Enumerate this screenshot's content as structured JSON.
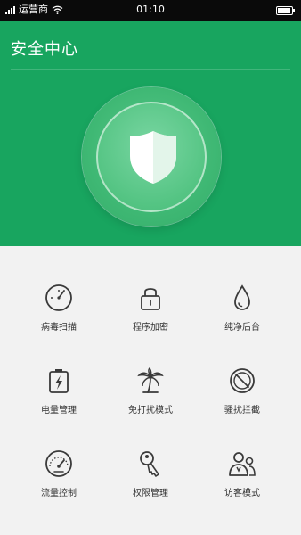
{
  "status_bar": {
    "carrier": "运营商",
    "time": "01:10"
  },
  "header": {
    "title": "安全中心"
  },
  "features": [
    {
      "label": "病毒扫描",
      "icon": "virus-scan-dial-icon"
    },
    {
      "label": "程序加密",
      "icon": "padlock-icon"
    },
    {
      "label": "纯净后台",
      "icon": "water-drop-icon"
    },
    {
      "label": "电量管理",
      "icon": "battery-bolt-icon"
    },
    {
      "label": "免打扰模式",
      "icon": "palm-tree-icon"
    },
    {
      "label": "骚扰拦截",
      "icon": "block-circle-icon"
    },
    {
      "label": "流量控制",
      "icon": "speedometer-icon"
    },
    {
      "label": "权限管理",
      "icon": "key-icon"
    },
    {
      "label": "访客模式",
      "icon": "visitor-people-icon"
    }
  ],
  "colors": {
    "hero_green": "#18a55f",
    "background": "#f2f2f2",
    "icon": "#3a3a3a"
  }
}
